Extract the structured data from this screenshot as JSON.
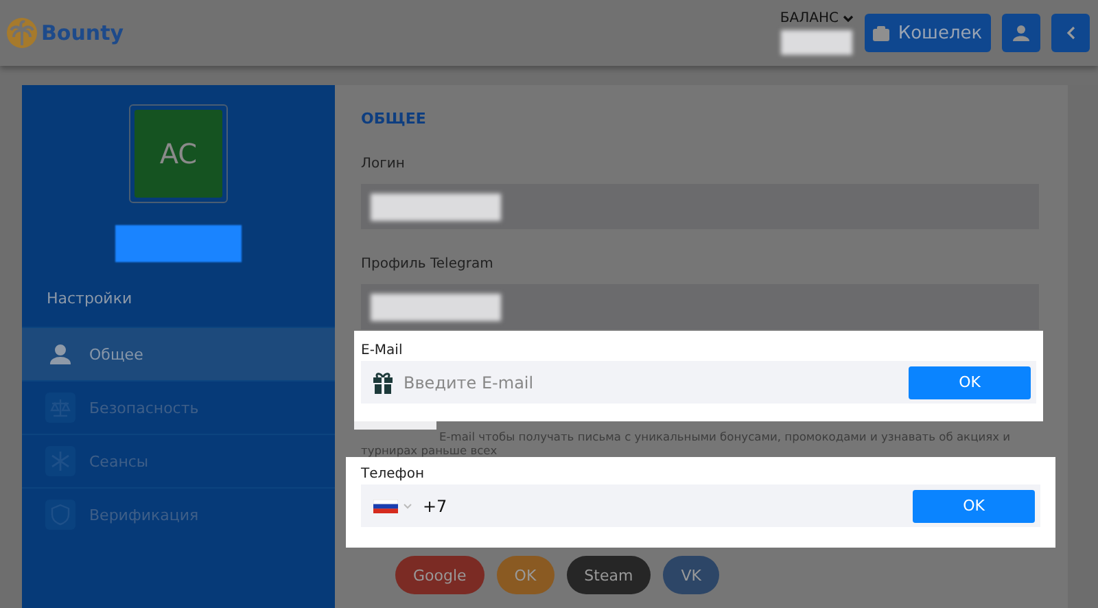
{
  "header": {
    "logo": "Bounty",
    "balance_label": "БАЛАНС",
    "wallet_button": "Кошелек"
  },
  "sidebar": {
    "avatar_initials": "AC",
    "section_title": "Настройки",
    "items": [
      {
        "label": "Общее",
        "kind": "user",
        "selected": true
      },
      {
        "label": "Безопасность",
        "kind": "scales",
        "selected": false
      },
      {
        "label": "Сеансы",
        "kind": "sessions",
        "selected": false
      },
      {
        "label": "Верификация",
        "kind": "shield",
        "selected": false
      }
    ]
  },
  "main": {
    "title": "ОБЩЕЕ",
    "fields": [
      {
        "label": "Логин"
      },
      {
        "label": "Профиль Telegram"
      }
    ],
    "email": {
      "label": "E-Mail",
      "placeholder": "Введите E-mail",
      "button": "OK"
    },
    "email_hint": "E-mail чтобы получать письма с уникальными бонусами, промокодами и узнавать об акциях и турнирах раньше всех",
    "phone": {
      "label": "Телефон",
      "value": "+7",
      "button": "OK"
    },
    "social_buttons": [
      {
        "label": "Google",
        "color": "#7b2b24"
      },
      {
        "label": "OK",
        "color": "#8a5a22"
      },
      {
        "label": "Steam",
        "color": "#262626"
      },
      {
        "label": "VK",
        "color": "#2d4667"
      }
    ]
  }
}
